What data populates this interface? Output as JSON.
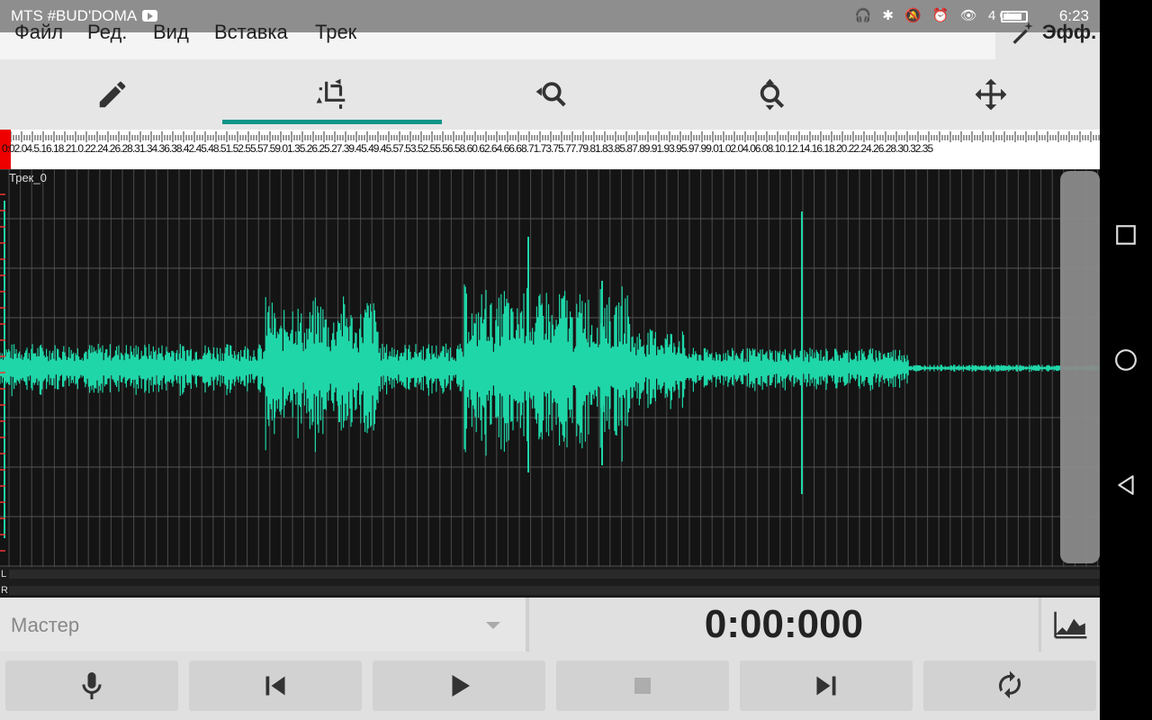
{
  "status_bar": {
    "carrier": "MTS #BUD'DOMA",
    "icons": [
      "headphones-icon",
      "bluetooth-icon",
      "mute-icon",
      "alarm-icon",
      "eye-icon",
      "signal-icon",
      "battery-icon"
    ],
    "network": "4G",
    "time": "6:23"
  },
  "menu": {
    "items": [
      "Файл",
      "Ред.",
      "Вид",
      "Вставка",
      "Трек"
    ],
    "effects_label": "Эфф."
  },
  "toolbar": {
    "tools": [
      "pencil-icon",
      "crop-select-icon",
      "zoom-horizontal-icon",
      "zoom-vertical-icon",
      "move-icon"
    ],
    "active_tool": "crop-select-icon"
  },
  "timeline": {
    "ruler_text": "0:02.04.5.16.18.21.0.22.24.26.28.31.34.36.38.42.45.48.51.52.55.57.59.01.35.26.25.27.39.45.49.45.57.53.52.55.56.58.60.62.64.66.68.71.73.75.77.79.81.83.85.87.89.91.93.95.97.99.01.02.04.06.08.10.12.14.16.18.20.22.24.26.28.30.32.35"
  },
  "track": {
    "name": "Трек_0",
    "channels": [
      "L",
      "R"
    ]
  },
  "colors": {
    "waveform": "#1fd6a8",
    "accent": "#0e9488",
    "playhead": "#e00000"
  },
  "bottom": {
    "master_label": "Мастер",
    "time": "0:00:000",
    "spectrum_icon": "spectrum-icon",
    "transport": [
      "microphone-icon",
      "skip-back-icon",
      "play-icon",
      "stop-icon",
      "skip-forward-icon",
      "loop-icon"
    ]
  }
}
